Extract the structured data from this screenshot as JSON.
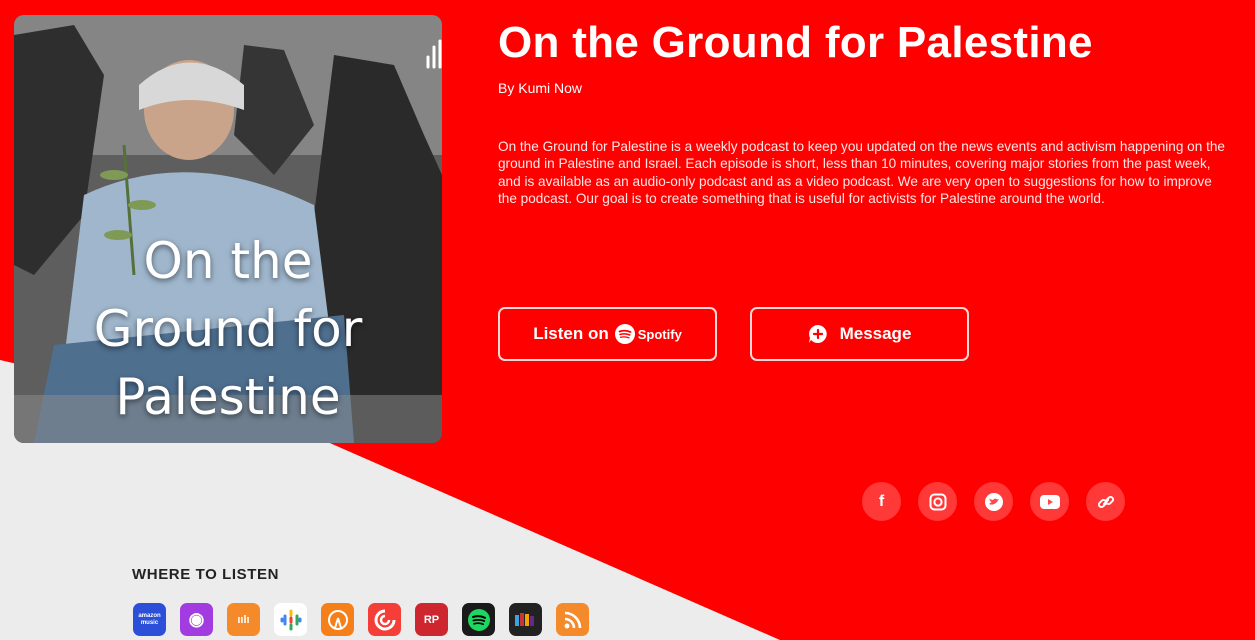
{
  "podcast": {
    "title": "On the Ground for Palestine",
    "author": "By Kumi Now",
    "description": "On the Ground for Palestine is a weekly podcast to keep you updated on the news events and activism happening on the ground in Palestine and Israel. Each episode is short, less than 10 minutes, covering major stories from the past week, and is available as an audio-only podcast and as a video podcast. We are very open to suggestions for how to improve the podcast. Our goal is to create something that is useful for activists for Palestine around the world.",
    "cover_text": [
      "On the",
      "Ground for",
      "Palestine"
    ]
  },
  "buttons": {
    "listen_label": "Listen on",
    "spotify_label": "Spotify",
    "message_label": "Message"
  },
  "social": [
    {
      "name": "facebook",
      "glyph": "f"
    },
    {
      "name": "instagram",
      "glyph": "◎"
    },
    {
      "name": "twitter",
      "glyph": "🐦"
    },
    {
      "name": "youtube",
      "glyph": "▶"
    },
    {
      "name": "link",
      "glyph": "🔗"
    }
  ],
  "where_to_listen": {
    "heading": "WHERE TO LISTEN",
    "apps": [
      {
        "name": "amazon-music",
        "color": "#2b4fd8",
        "glyph": "amazon music"
      },
      {
        "name": "apple-podcasts",
        "color": "#a23be0",
        "glyph": "◉"
      },
      {
        "name": "castbox",
        "color": "#f58a2b",
        "glyph": "ıılı"
      },
      {
        "name": "google-podcasts",
        "color": "#ffffff",
        "glyph": "⁞"
      },
      {
        "name": "overcast",
        "color": "#f57f18",
        "glyph": "◍"
      },
      {
        "name": "pocket-casts",
        "color": "#f43e37",
        "glyph": "◐"
      },
      {
        "name": "radiopublic",
        "color": "#ce262f",
        "glyph": "RP"
      },
      {
        "name": "spotify",
        "color": "#1ed760",
        "glyph": "≋"
      },
      {
        "name": "stitcher",
        "color": "#222222",
        "glyph": "▮▮▮"
      },
      {
        "name": "rss",
        "color": "#f58a2b",
        "glyph": ")))"
      }
    ]
  },
  "colors": {
    "brand_red": "#ff0000",
    "background": "#ffffff",
    "light_gray": "#ececec"
  }
}
